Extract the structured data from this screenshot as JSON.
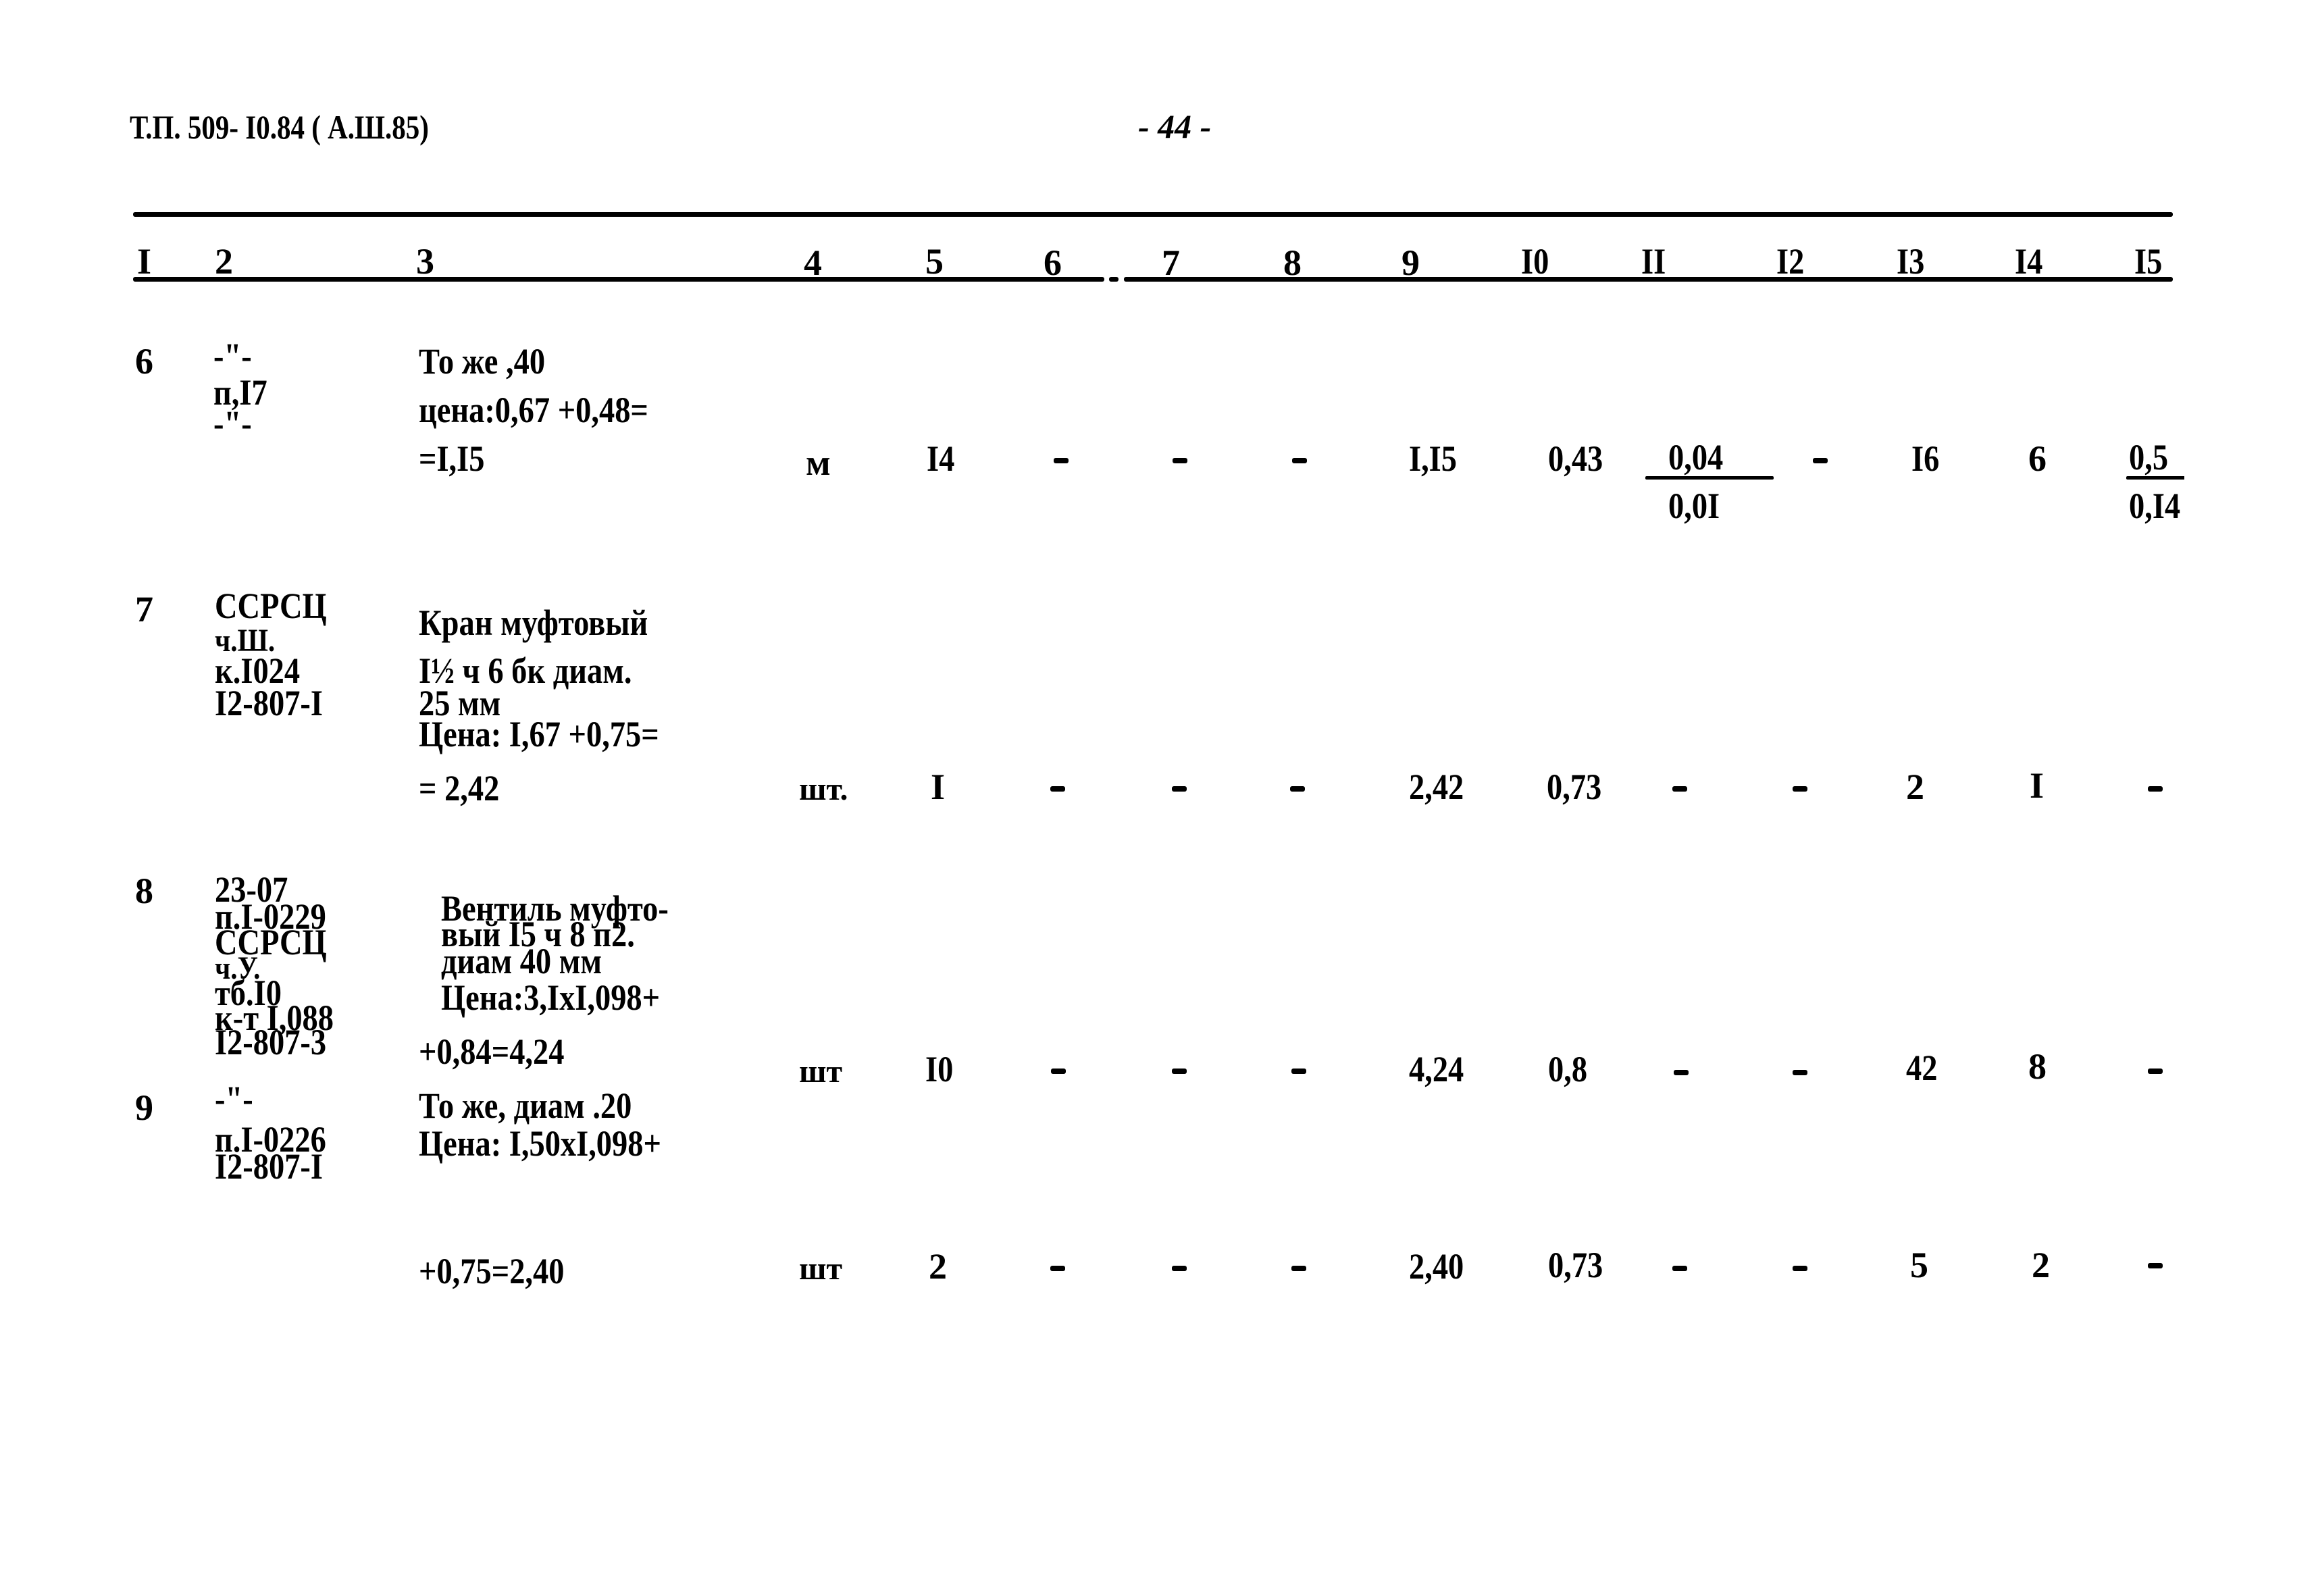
{
  "header": {
    "doc_ref": "Т.П. 509- I0.84 ( А.Ш.85)",
    "page_number": "- 44 -"
  },
  "table": {
    "column_numbers": [
      "I",
      "2",
      "3",
      "4",
      "5",
      "6",
      "7",
      "8",
      "9",
      "I0",
      "II",
      "I2",
      "I3",
      "I4",
      "I5"
    ],
    "rows": [
      {
        "num": "6",
        "ref": [
          "-\"-",
          "п,I7",
          "-\"-"
        ],
        "desc": [
          "То же ,40",
          "цена:0,67 +0,48=",
          "=I,I5"
        ],
        "unit": "м",
        "qty": "I4",
        "c6": "-",
        "c7": "-",
        "c8": "-",
        "c9": "I,I5",
        "c10": "0,43",
        "c11": {
          "top": "0,04",
          "bottom": "0,0I"
        },
        "c12": "-",
        "c13": "I6",
        "c14": "6",
        "c15": {
          "top": "0,5",
          "bottom": "0,I4"
        }
      },
      {
        "num": "7",
        "ref": [
          "ССРСЦ",
          "ч.Ш.",
          "к.I024",
          "I2-807-I"
        ],
        "desc": [
          "Кран муфтовый",
          "I½ ч 6 бк диам.",
          "25 мм",
          "Цена: I,67 +0,75=",
          "= 2,42"
        ],
        "unit": "шт.",
        "qty": "I",
        "c6": "-",
        "c7": "-",
        "c8": "-",
        "c9": "2,42",
        "c10": "0,73",
        "c11": "-",
        "c12": "-",
        "c13": "2",
        "c14": "I",
        "c15": "-"
      },
      {
        "num": "8",
        "ref": [
          "23-07",
          "п.I-0229",
          "ССРСЦ",
          "ч.У.",
          "тб.I0",
          "к-т I,088",
          "I2-807-3"
        ],
        "desc": [
          "Вентиль муфто-",
          "вый I5 ч 8 п2.",
          "диам 40 мм",
          "Цена:3,IxI,098+",
          "+0,84=4,24"
        ],
        "unit": "шт",
        "qty": "I0",
        "c6": "-",
        "c7": "-",
        "c8": "-",
        "c9": "4,24",
        "c10": "0,8",
        "c11": "-",
        "c12": "-",
        "c13": "42",
        "c14": "8",
        "c15": "-"
      },
      {
        "num": "9",
        "ref": [
          "-\"-",
          "п.I-0226",
          "I2-807-I"
        ],
        "desc": [
          "То же, диам .20",
          "Цена: I,50xI,098+",
          "+0,75=2,40"
        ],
        "unit": "шт",
        "qty": "2",
        "c6": "-",
        "c7": "-",
        "c8": "-",
        "c9": "2,40",
        "c10": "0,73",
        "c11": "-",
        "c12": "-",
        "c13": "5",
        "c14": "2",
        "c15": "-"
      }
    ]
  }
}
